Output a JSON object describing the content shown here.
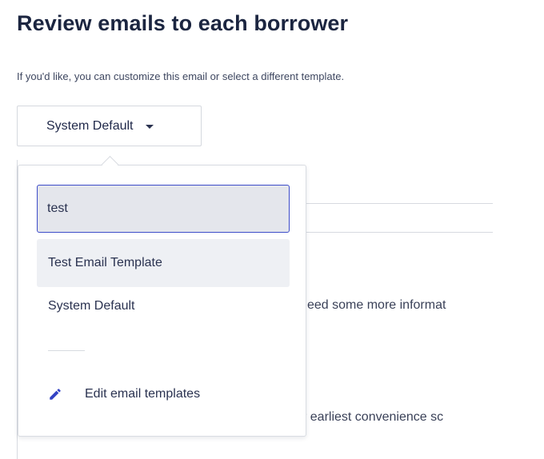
{
  "header": {
    "title": "Review emails to each borrower",
    "subtitle": "If you'd like, you can customize this email or select a different template."
  },
  "template_select": {
    "selected": "System Default"
  },
  "background": {
    "line_fragment_1": "eed some more informat",
    "line_fragment_2": "r earliest convenience sc"
  },
  "popover": {
    "search": {
      "value": "test"
    },
    "options": [
      {
        "label": "Test Email Template",
        "highlighted": true
      },
      {
        "label": "System Default",
        "highlighted": false
      }
    ],
    "edit_label": "Edit email templates",
    "colors": {
      "accent": "#3d4cc9",
      "highlight": "#eef0f4"
    }
  },
  "icons": {
    "caret": "caret-down-icon",
    "edit": "pencil-icon"
  }
}
